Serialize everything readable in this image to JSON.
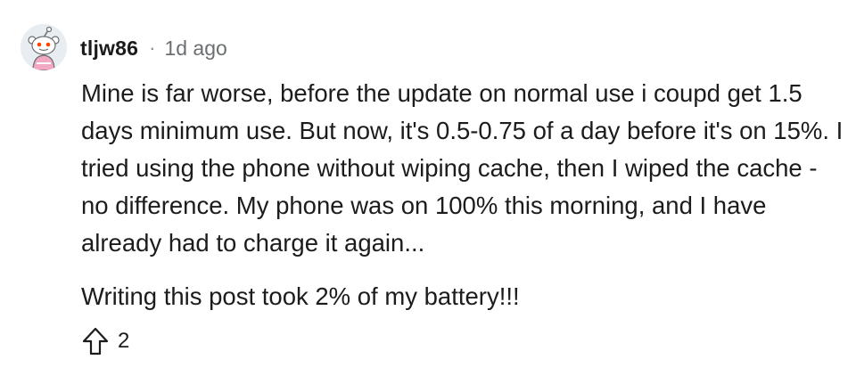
{
  "comment": {
    "avatar_icon": "snoo-avatar-icon",
    "username": "tljw86",
    "separator": "·",
    "timestamp": "1d ago",
    "paragraphs": [
      "Mine is far worse, before the update on normal use i coupd get 1.5 days minimum use. But now, it's 0.5-0.75 of a day before it's on 15%. I tried using the phone without wiping cache, then I wiped the cache - no difference. My phone was on 100% this morning, and I have already had to charge it again...",
      "Writing this post took 2% of my battery!!!"
    ],
    "upvote_icon": "upvote-arrow-icon",
    "score": "2"
  },
  "colors": {
    "text": "#1c1c1c",
    "meta": "#6b6f72",
    "avatar_bg": "#e8edf1",
    "snoo_accent": "#ff4500"
  }
}
